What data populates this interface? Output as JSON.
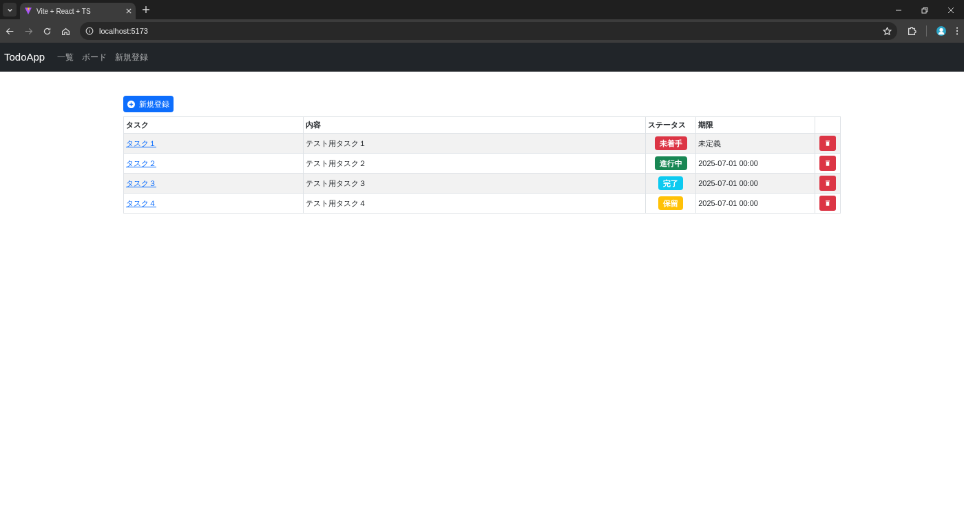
{
  "browser": {
    "tab_title": "Vite + React + TS",
    "url": "localhost:5173"
  },
  "navbar": {
    "brand": "TodoApp",
    "links": [
      "一覧",
      "ボード",
      "新規登録"
    ]
  },
  "new_button": "新規登録",
  "table": {
    "columns": [
      "タスク",
      "内容",
      "ステータス",
      "期限",
      ""
    ],
    "rows": [
      {
        "task": "タスク１",
        "content": "テスト用タスク１",
        "status": "未着手",
        "color": "#dc3545",
        "due": "未定義",
        "striped": true
      },
      {
        "task": "タスク２",
        "content": "テスト用タスク２",
        "status": "進行中",
        "color": "#198754",
        "due": "2025-07-01 00:00",
        "striped": false
      },
      {
        "task": "タスク３",
        "content": "テスト用タスク３",
        "status": "完了",
        "color": "#0dcaf0",
        "due": "2025-07-01 00:00",
        "striped": true
      },
      {
        "task": "タスク４",
        "content": "テスト用タスク４",
        "status": "保留",
        "color": "#ffc107",
        "due": "2025-07-01 00:00",
        "striped": false
      }
    ]
  }
}
